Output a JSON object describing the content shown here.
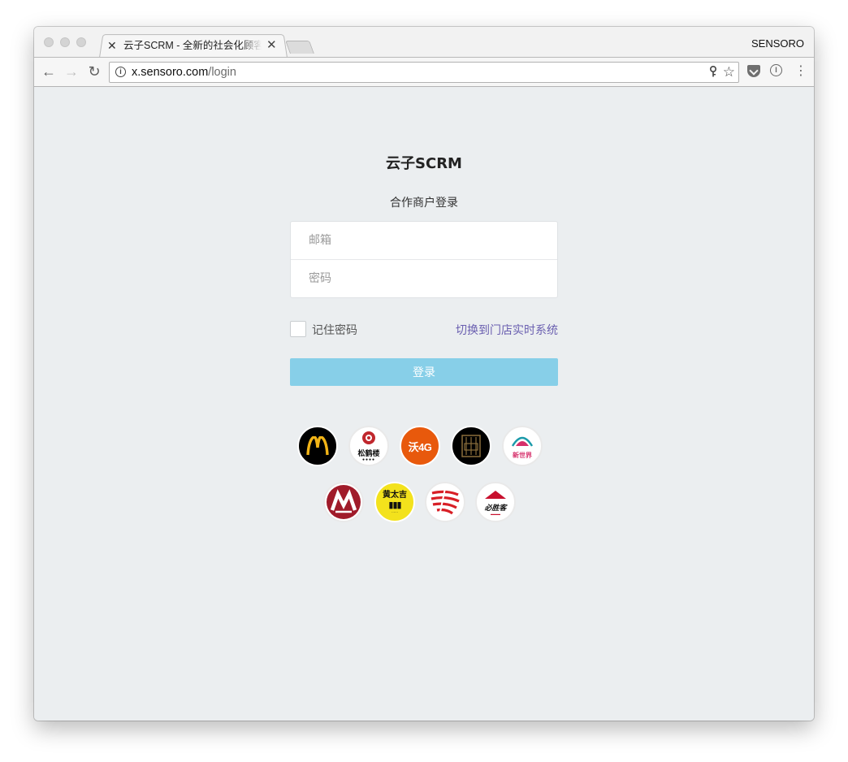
{
  "browser": {
    "tab": {
      "title": "云子SCRM - 全新的社会化顾客关系管理",
      "favicon": "sensoro-x-icon"
    },
    "profile": "SENSORO",
    "address_bar": {
      "host": "x.sensoro.com",
      "path": "/login"
    }
  },
  "login": {
    "brand": "云子SCRM",
    "subtitle": "合作商户登录",
    "email_placeholder": "邮箱",
    "password_placeholder": "密码",
    "remember_label": "记住密码",
    "remember_checked": false,
    "switch_link": "切换到门店实时系统",
    "submit_label": "登录",
    "submit_color": "#87cfe8",
    "link_color": "#6a5fb0"
  },
  "partner_logos": {
    "row1": [
      {
        "name": "mcdonalds-logo",
        "mark": "M",
        "bg": "#000000",
        "fg": "#f2b417"
      },
      {
        "name": "songhelou-logo",
        "mark": "松鹤楼",
        "bg": "#ffffff",
        "fg": "#c0272d"
      },
      {
        "name": "wo4g-logo",
        "mark": "沃4G",
        "bg": "#e8590c",
        "fg": "#ffffff"
      },
      {
        "name": "dark-brand-logo",
        "mark": "",
        "bg": "#000000",
        "fg": "#8a6d3b"
      },
      {
        "name": "new-world-logo",
        "mark": "新世界",
        "bg": "#ffffff",
        "fg": "#d6306b"
      }
    ],
    "row2": [
      {
        "name": "cmb-logo",
        "mark": "",
        "bg": "#ffffff",
        "fg": "#a01b2a"
      },
      {
        "name": "huangtaiji-logo",
        "mark": "黄太吉",
        "bg": "#f3e21c",
        "fg": "#111111"
      },
      {
        "name": "red-stripes-logo",
        "mark": "",
        "bg": "#ffffff",
        "fg": "#d81f26"
      },
      {
        "name": "pizzahut-logo",
        "mark": "必胜客",
        "bg": "#ffffff",
        "fg": "#c8102e"
      }
    ]
  }
}
